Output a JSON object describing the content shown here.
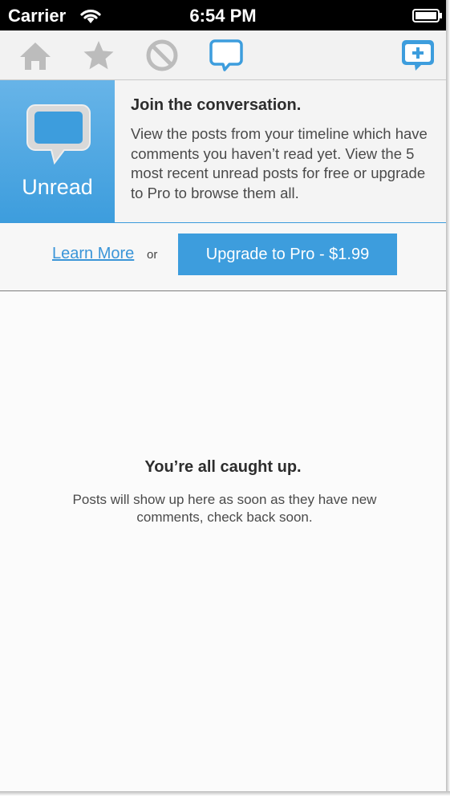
{
  "status_bar": {
    "carrier": "Carrier",
    "time": "6:54 PM",
    "icons": [
      "wifi-icon",
      "battery-icon"
    ]
  },
  "toolbar": {
    "buttons": [
      {
        "name": "home",
        "icon": "home-icon",
        "active": false
      },
      {
        "name": "favorites",
        "icon": "star-icon",
        "active": false
      },
      {
        "name": "muted",
        "icon": "block-icon",
        "active": false
      },
      {
        "name": "unread",
        "icon": "chat-bubble-icon",
        "active": true
      },
      {
        "name": "compose",
        "icon": "compose-plus-icon",
        "active": true
      }
    ]
  },
  "promo": {
    "tile_label": "Unread",
    "tile_icon": "chat-bubble-icon",
    "title": "Join the conversation.",
    "body": "View the posts from your timeline which have comments you haven’t read yet. View the 5 most recent unread posts for free or upgrade to Pro to browse them all.",
    "learn_more": "Learn More",
    "or": "or",
    "upgrade": "Upgrade to Pro - $1.99"
  },
  "empty_state": {
    "title": "You’re all caught up.",
    "body": "Posts will show up here as soon as they have new comments, check back soon."
  },
  "colors": {
    "accent": "#3d9ddd",
    "inactive_icon": "#b9b9b9",
    "status_bar": "#000000"
  }
}
